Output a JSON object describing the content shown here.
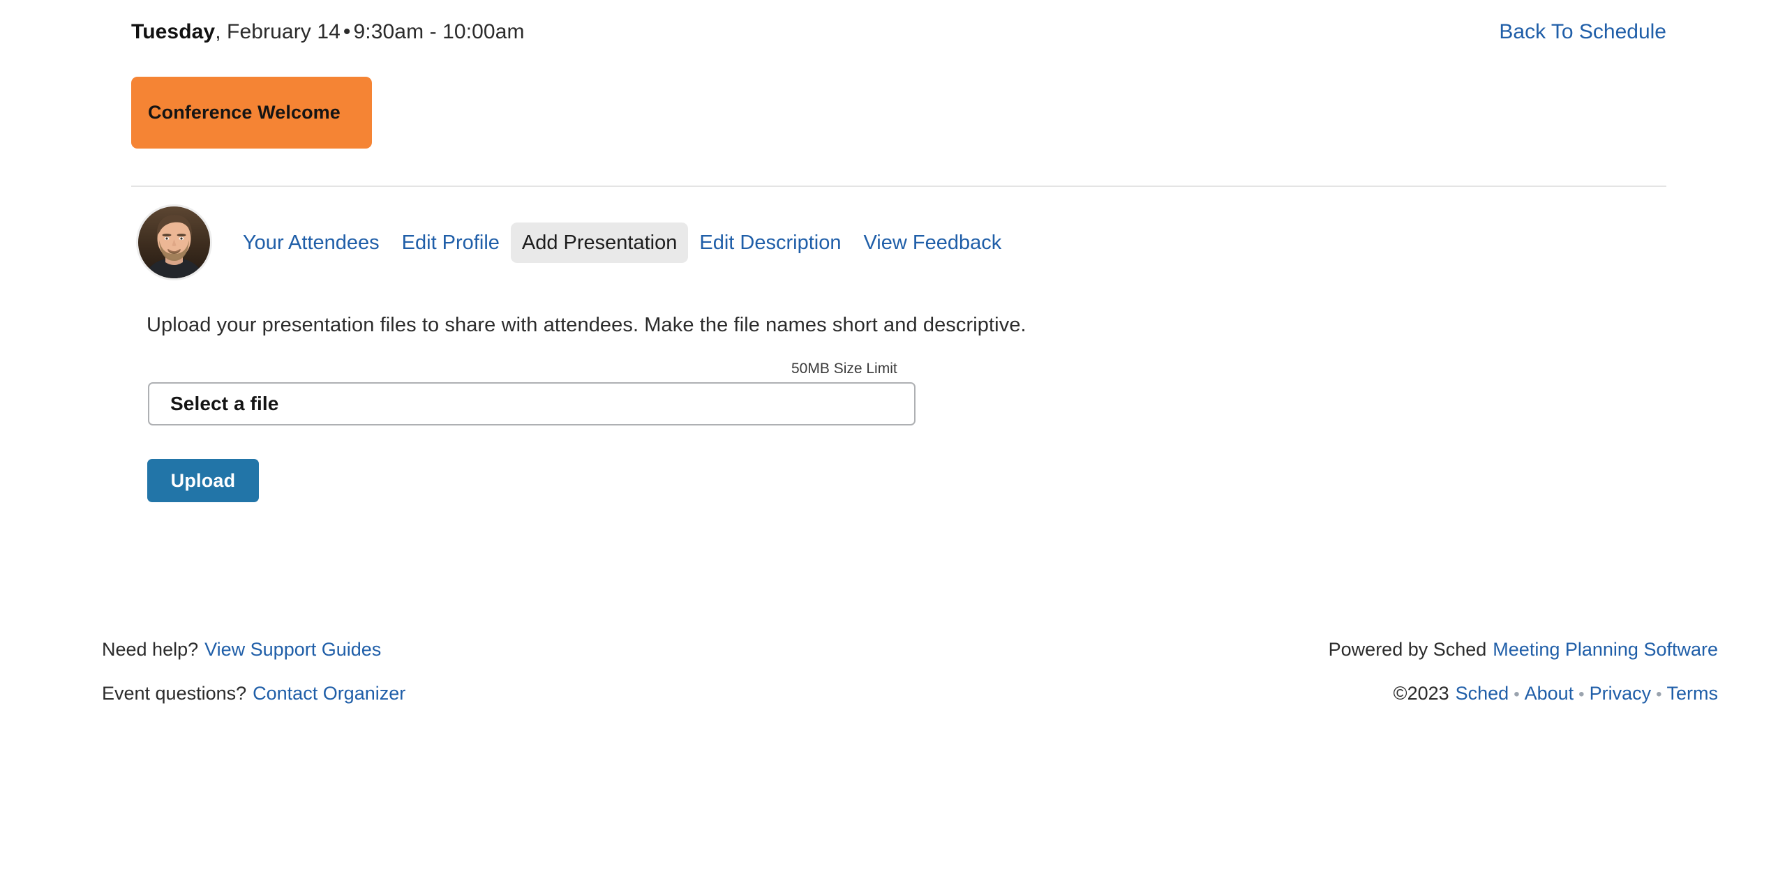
{
  "header": {
    "day": "Tuesday",
    "date_rest": ", February 14",
    "separator": "•",
    "time_range": "9:30am - 10:00am",
    "back_link": "Back To Schedule"
  },
  "session": {
    "badge_label": "Conference Welcome",
    "badge_color": "#f58434"
  },
  "nav": {
    "avatar_name": "speaker-avatar",
    "tabs": [
      {
        "label": "Your Attendees",
        "active": false
      },
      {
        "label": "Edit Profile",
        "active": false
      },
      {
        "label": "Add Presentation",
        "active": true
      },
      {
        "label": "Edit Description",
        "active": false
      },
      {
        "label": "View Feedback",
        "active": false
      }
    ]
  },
  "main": {
    "instructions": "Upload your presentation files to share with attendees. Make the file names short and descriptive.",
    "size_limit": "50MB Size Limit",
    "file_select_label": "Select a file",
    "upload_button": "Upload",
    "upload_button_color": "#2275a8"
  },
  "footer": {
    "need_help_text": "Need help?",
    "support_link": "View Support Guides",
    "event_questions_text": "Event questions?",
    "contact_link": "Contact Organizer",
    "powered_by_text": "Powered by Sched",
    "powered_by_link": "Meeting Planning Software",
    "copyright": "©2023",
    "links": [
      "Sched",
      "About",
      "Privacy",
      "Terms"
    ],
    "bullet": "•"
  },
  "colors": {
    "link": "#1f5ea8",
    "accent_orange": "#f58434",
    "button_blue": "#2275a8",
    "active_tab_bg": "#e9e9e9",
    "divider": "#e4e4e4"
  }
}
